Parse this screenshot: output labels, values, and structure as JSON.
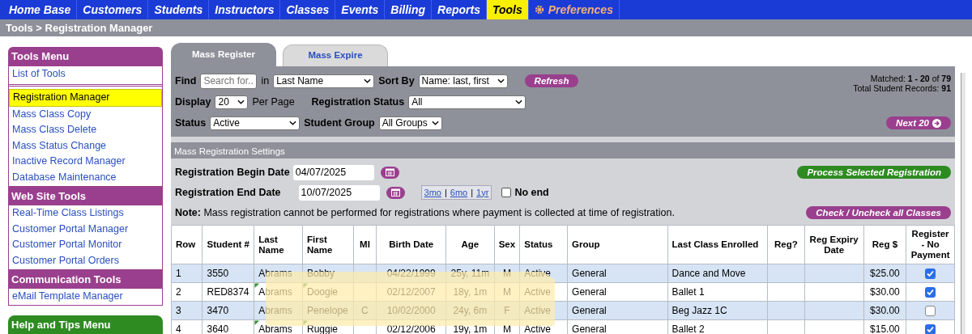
{
  "nav": [
    {
      "label": "Home Base",
      "kind": "link",
      "selected": false
    },
    {
      "label": "Customers",
      "kind": "link",
      "selected": false
    },
    {
      "label": "Students",
      "kind": "link",
      "selected": false
    },
    {
      "label": "Instructors",
      "kind": "link",
      "selected": false
    },
    {
      "label": "Classes",
      "kind": "link",
      "selected": false
    },
    {
      "label": "Events",
      "kind": "link",
      "selected": false
    },
    {
      "label": "Billing",
      "kind": "link",
      "selected": false
    },
    {
      "label": "Reports",
      "kind": "link",
      "selected": false
    },
    {
      "label": "Tools",
      "kind": "link",
      "selected": true
    },
    {
      "label": "Preferences",
      "kind": "settings",
      "selected": false
    }
  ],
  "breadcrumb": "Tools > Registration Manager",
  "sidebar": [
    {
      "title": "Tools Menu",
      "color": "#9a3f8e",
      "groups": [
        [
          {
            "label": "List of Tools",
            "selected": false
          }
        ],
        [
          {
            "label": "Registration Manager",
            "selected": true
          },
          {
            "label": "Mass Class Copy",
            "selected": false
          },
          {
            "label": "Mass Class Delete",
            "selected": false
          },
          {
            "label": "Mass Status Change",
            "selected": false
          },
          {
            "label": "Inactive Record Manager",
            "selected": false
          },
          {
            "label": "Database Maintenance",
            "selected": false
          }
        ]
      ]
    },
    {
      "title": "Web Site Tools",
      "color": "#9a3f8e",
      "groups": [
        [
          {
            "label": "Real-Time Class Listings",
            "selected": false
          },
          {
            "label": "Customer Portal Manager",
            "selected": false
          },
          {
            "label": "Customer Portal Monitor",
            "selected": false
          },
          {
            "label": "Customer Portal Orders",
            "selected": false
          }
        ]
      ]
    },
    {
      "title": "Communication Tools",
      "color": "#9a3f8e",
      "groups": [
        [
          {
            "label": "eMail Template Manager",
            "selected": false
          }
        ]
      ]
    },
    {
      "title": "Help and Tips Menu",
      "color": "#2e8b22"
    }
  ],
  "tabs": [
    {
      "label": "Mass Register",
      "selected": true
    },
    {
      "label": "Mass Expire",
      "selected": false
    }
  ],
  "filters": {
    "find_label": "Find",
    "find_placeholder": "Search for...",
    "in_label": "in",
    "in_value": "Last Name",
    "sort_label": "Sort By",
    "sort_value": "Name: last, first",
    "refresh": "Refresh",
    "matched": "Matched: **1 - 20** of **79**",
    "total": "Total Student Records: **91**",
    "display_label": "Display",
    "display_value": "20",
    "per_page": "Per Page",
    "reg_status_label": "Registration Status",
    "reg_status_value": "All",
    "status_label": "Status",
    "status_value": "Active",
    "group_label": "Student Group",
    "group_value": "All Groups",
    "next": "Next 20"
  },
  "settings": {
    "title": "Mass Registration Settings",
    "begin_label": "Registration Begin Date",
    "begin_value": "04/07/2025",
    "end_label": "Registration End Date",
    "end_value": "10/07/2025",
    "quick_links": [
      "3mo",
      "6mo",
      "1yr"
    ],
    "quick_separator": "|",
    "no_end_label": "No end",
    "no_end_checked": false,
    "process": "Process Selected Registration",
    "note": "**Note:** Mass registration cannot be performed for registrations where payment is collected at time of registration.",
    "check_all": "Check / Uncheck all Classes"
  },
  "table": {
    "columns": [
      "Row",
      "Student #",
      "Last Name",
      "First Name",
      "MI",
      "Birth Date",
      "Age",
      "Sex",
      "Status",
      "Group",
      "Last Class Enrolled",
      "Reg?",
      "Reg Expiry Date",
      "Reg $",
      "Register - No Payment"
    ],
    "rows": [
      {
        "row": "1",
        "student": "3550",
        "last": "Abrams",
        "first": "Bobby",
        "birth": "04/22/1999",
        "age": "25y, 11m",
        "sex": "M",
        "status": "Active",
        "group": "General",
        "last_class": "Dance and Move",
        "amount": "$25.00",
        "checked": true
      },
      {
        "row": "2",
        "student": "RED8374",
        "last": "Abrams",
        "first": "Doogie",
        "birth": "02/12/2007",
        "age": "18y, 1m",
        "sex": "M",
        "status": "Active",
        "group": "General",
        "last_class": "Ballet 1",
        "amount": "$30.00",
        "checked": true
      },
      {
        "row": "3",
        "student": "3470",
        "last": "Abrams",
        "first": "Penelope",
        "mi": "C",
        "birth": "10/02/2000",
        "age": "24y, 6m",
        "sex": "F",
        "status": "Active",
        "group": "General",
        "last_class": "Beg Jazz 1C",
        "amount": "$30.00",
        "checked": false
      },
      {
        "row": "4",
        "student": "3640",
        "last": "Abrams",
        "first": "Ruggie",
        "birth": "02/12/2006",
        "age": "19y, 1m",
        "sex": "M",
        "status": "Active",
        "group": "General",
        "last_class": "Ballet 2",
        "amount": "$15.00",
        "checked": true
      }
    ]
  }
}
